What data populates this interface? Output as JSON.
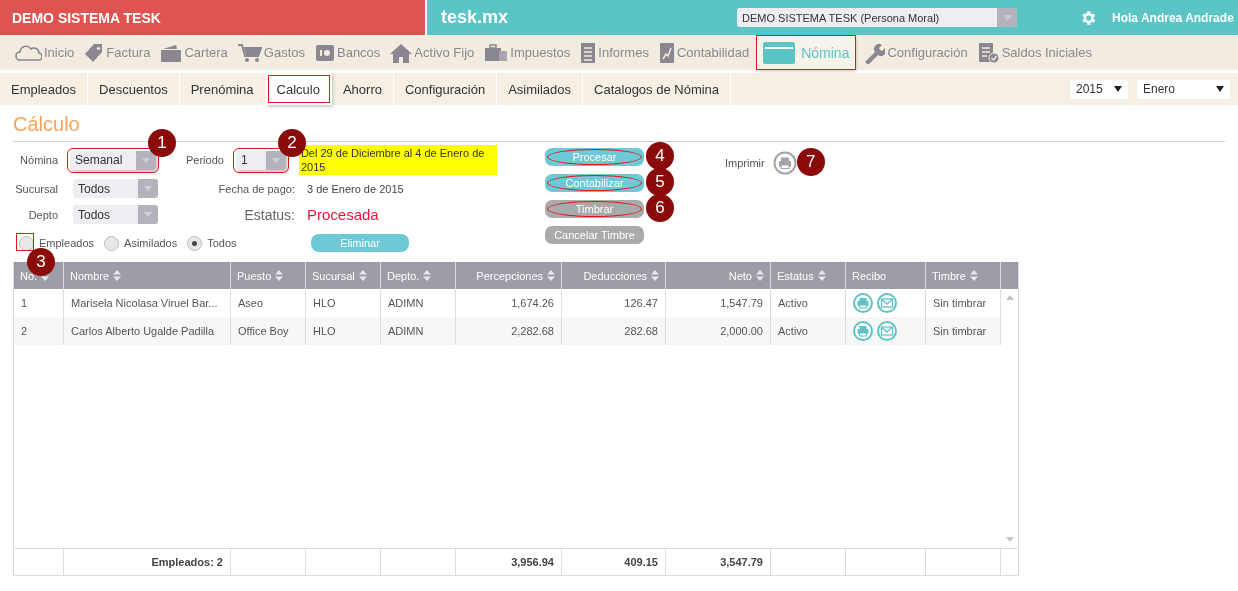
{
  "header": {
    "brand": "DEMO SISTEMA TESK",
    "site": "tesk.mx",
    "company_select": "DEMO SISTEMA TESK (Persona Moral)",
    "greeting": "Hola Andrea Andrade"
  },
  "nav": [
    {
      "label": "Inicio",
      "selected": false,
      "highlighted": false
    },
    {
      "label": "Factura",
      "selected": false,
      "highlighted": false
    },
    {
      "label": "Cartera",
      "selected": false,
      "highlighted": false
    },
    {
      "label": "Gastos",
      "selected": false,
      "highlighted": false
    },
    {
      "label": "Bancos",
      "selected": false,
      "highlighted": false
    },
    {
      "label": "Activo Fijo",
      "selected": false,
      "highlighted": false
    },
    {
      "label": "Impuestos",
      "selected": false,
      "highlighted": false
    },
    {
      "label": "Informes",
      "selected": false,
      "highlighted": false
    },
    {
      "label": "Contabilidad",
      "selected": false,
      "highlighted": false
    },
    {
      "label": "Nómina",
      "selected": true,
      "highlighted": true
    },
    {
      "label": "Configuración",
      "selected": false,
      "highlighted": false
    },
    {
      "label": "Saldos Iniciales",
      "selected": false,
      "highlighted": false
    }
  ],
  "subtabs": [
    {
      "label": "Empleados",
      "selected": false,
      "highlighted": false
    },
    {
      "label": "Descuentos",
      "selected": false,
      "highlighted": false
    },
    {
      "label": "Prenómina",
      "selected": false,
      "highlighted": false
    },
    {
      "label": "Calculo",
      "selected": true,
      "highlighted": true
    },
    {
      "label": "Ahorro",
      "selected": false,
      "highlighted": false
    },
    {
      "label": "Configuración",
      "selected": false,
      "highlighted": false
    },
    {
      "label": "Asimilados",
      "selected": false,
      "highlighted": false
    },
    {
      "label": "Catalogos de Nómina",
      "selected": false,
      "highlighted": false
    }
  ],
  "year_select": "2015",
  "month_select": "Enero",
  "page_title": "Cálculo",
  "filters": {
    "nomina": {
      "label": "Nómina",
      "value": "Semanal",
      "highlighted": true,
      "callout": "1"
    },
    "periodo": {
      "label": "Periodo",
      "value": "1",
      "highlighted": true,
      "callout": "2"
    },
    "period_note": "Del 29 de Diciembre al 4 de Enero de 2015",
    "sucursal": {
      "label": "Sucursal",
      "value": "Todos",
      "highlighted": false
    },
    "depto": {
      "label": "Depto",
      "value": "Todos",
      "highlighted": false
    },
    "fecha_pago": {
      "label": "Fecha de pago:",
      "value": "3 de Enero de 2015"
    },
    "estatus": {
      "label": "Estatus:",
      "value": "Procesada"
    }
  },
  "radios": [
    {
      "label": "Empleados",
      "selected": false,
      "highlighted": true,
      "callout": "3"
    },
    {
      "label": "Asimilados",
      "selected": false,
      "highlighted": false
    },
    {
      "label": "Todos",
      "selected": true,
      "highlighted": false
    }
  ],
  "eliminar": "Eliminar",
  "actions": [
    {
      "label": "Procesar",
      "disabled": false,
      "highlighted": true,
      "callout": "4"
    },
    {
      "label": "Contabilizar",
      "disabled": false,
      "highlighted": true,
      "callout": "5"
    },
    {
      "label": "Timbrar",
      "disabled": true,
      "highlighted": true,
      "callout": "6"
    },
    {
      "label": "Cancelar Timbre",
      "disabled": true,
      "highlighted": false
    }
  ],
  "print": {
    "label": "Imprimir",
    "callout": "7"
  },
  "table": {
    "columns": [
      {
        "label": "No.",
        "sortable": true
      },
      {
        "label": "Nombre",
        "sortable": true
      },
      {
        "label": "Puesto",
        "sortable": true
      },
      {
        "label": "Sucursal",
        "sortable": true
      },
      {
        "label": "Depto.",
        "sortable": true
      },
      {
        "label": "Percepciones",
        "sortable": true
      },
      {
        "label": "Deducciones",
        "sortable": true
      },
      {
        "label": "Neto",
        "sortable": true
      },
      {
        "label": "Estatus",
        "sortable": true
      },
      {
        "label": "Recibo",
        "sortable": false,
        "kind": "icons"
      },
      {
        "label": "Timbre",
        "sortable": true
      }
    ],
    "rows": [
      {
        "cells": [
          "1",
          "Marisela Nicolasa Viruel Bar...",
          "Aseo",
          "HLO",
          "ADIMN",
          "1,674.26",
          "126.47",
          "1,547.79",
          "Activo",
          "Sin timbrar"
        ]
      },
      {
        "cells": [
          "2",
          "Carlos Alberto Ugalde Padilla",
          "Office Boy",
          "HLO",
          "ADIMN",
          "2,282.68",
          "282.68",
          "2,000.00",
          "Activo",
          "Sin timbrar"
        ]
      }
    ],
    "footer": {
      "label": "Empleados: 2",
      "totals": [
        "3,956.94",
        "409.15",
        "3,547.79"
      ]
    }
  }
}
